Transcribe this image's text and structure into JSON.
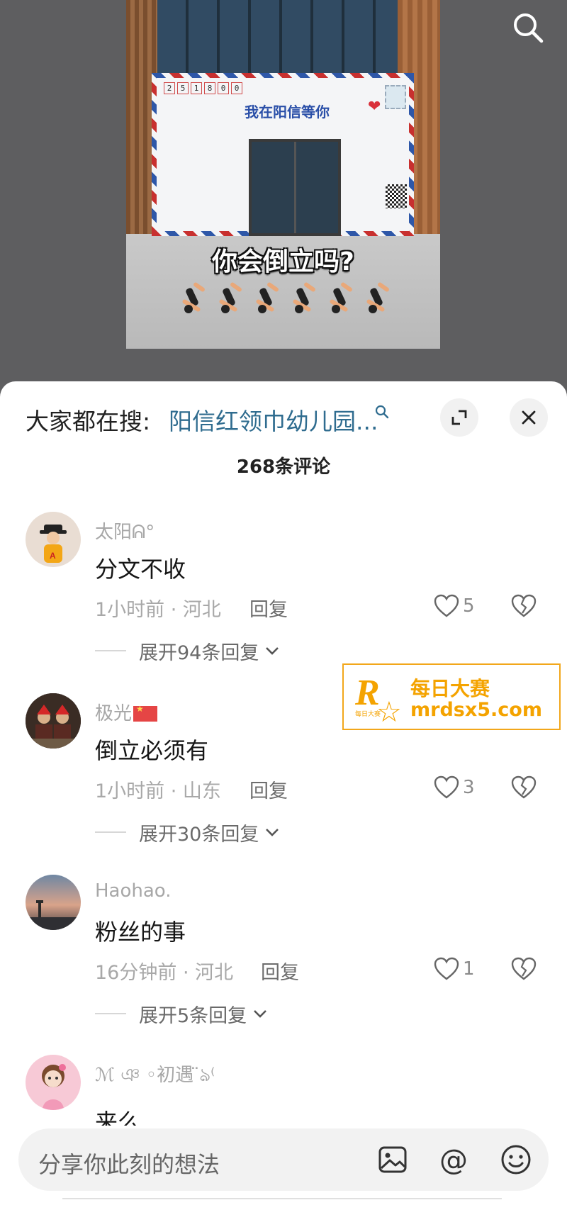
{
  "video": {
    "postcode": [
      "2",
      "5",
      "1",
      "8",
      "0",
      "0"
    ],
    "sign_text": "我在阳信等你",
    "caption": "你会倒立吗?"
  },
  "sheet": {
    "search_prefix": "大家都在搜:",
    "search_link": "阳信红领巾幼儿园...",
    "comment_count": "268条评论"
  },
  "comments": [
    {
      "username": "太阳ᕱ°",
      "text": "分文不收",
      "meta": "1小时前 · 河北",
      "reply": "回复",
      "likes": "5",
      "expand": "展开94条回复"
    },
    {
      "username": "极光",
      "text": "倒立必须有",
      "meta": "1小时前 · 山东",
      "reply": "回复",
      "likes": "3",
      "expand": "展开30条回复"
    },
    {
      "username": "Haohao.",
      "text": "粉丝的事",
      "meta": "16分钟前 · 河北",
      "reply": "回复",
      "likes": "1",
      "expand": "展开5条回复"
    },
    {
      "username": "ℳ ঞ ◦初遇 ̈ঌ⁽",
      "text": "来么",
      "meta": "",
      "reply": "",
      "likes": "",
      "expand": ""
    }
  ],
  "watermark": {
    "logo": "R",
    "small": "每日大赛",
    "name": "每日大赛",
    "url": "mrdsx5.com"
  },
  "input": {
    "placeholder": "分享你此刻的想法"
  },
  "colors": {
    "link": "#2f6c8f",
    "watermark": "#f4a300"
  }
}
